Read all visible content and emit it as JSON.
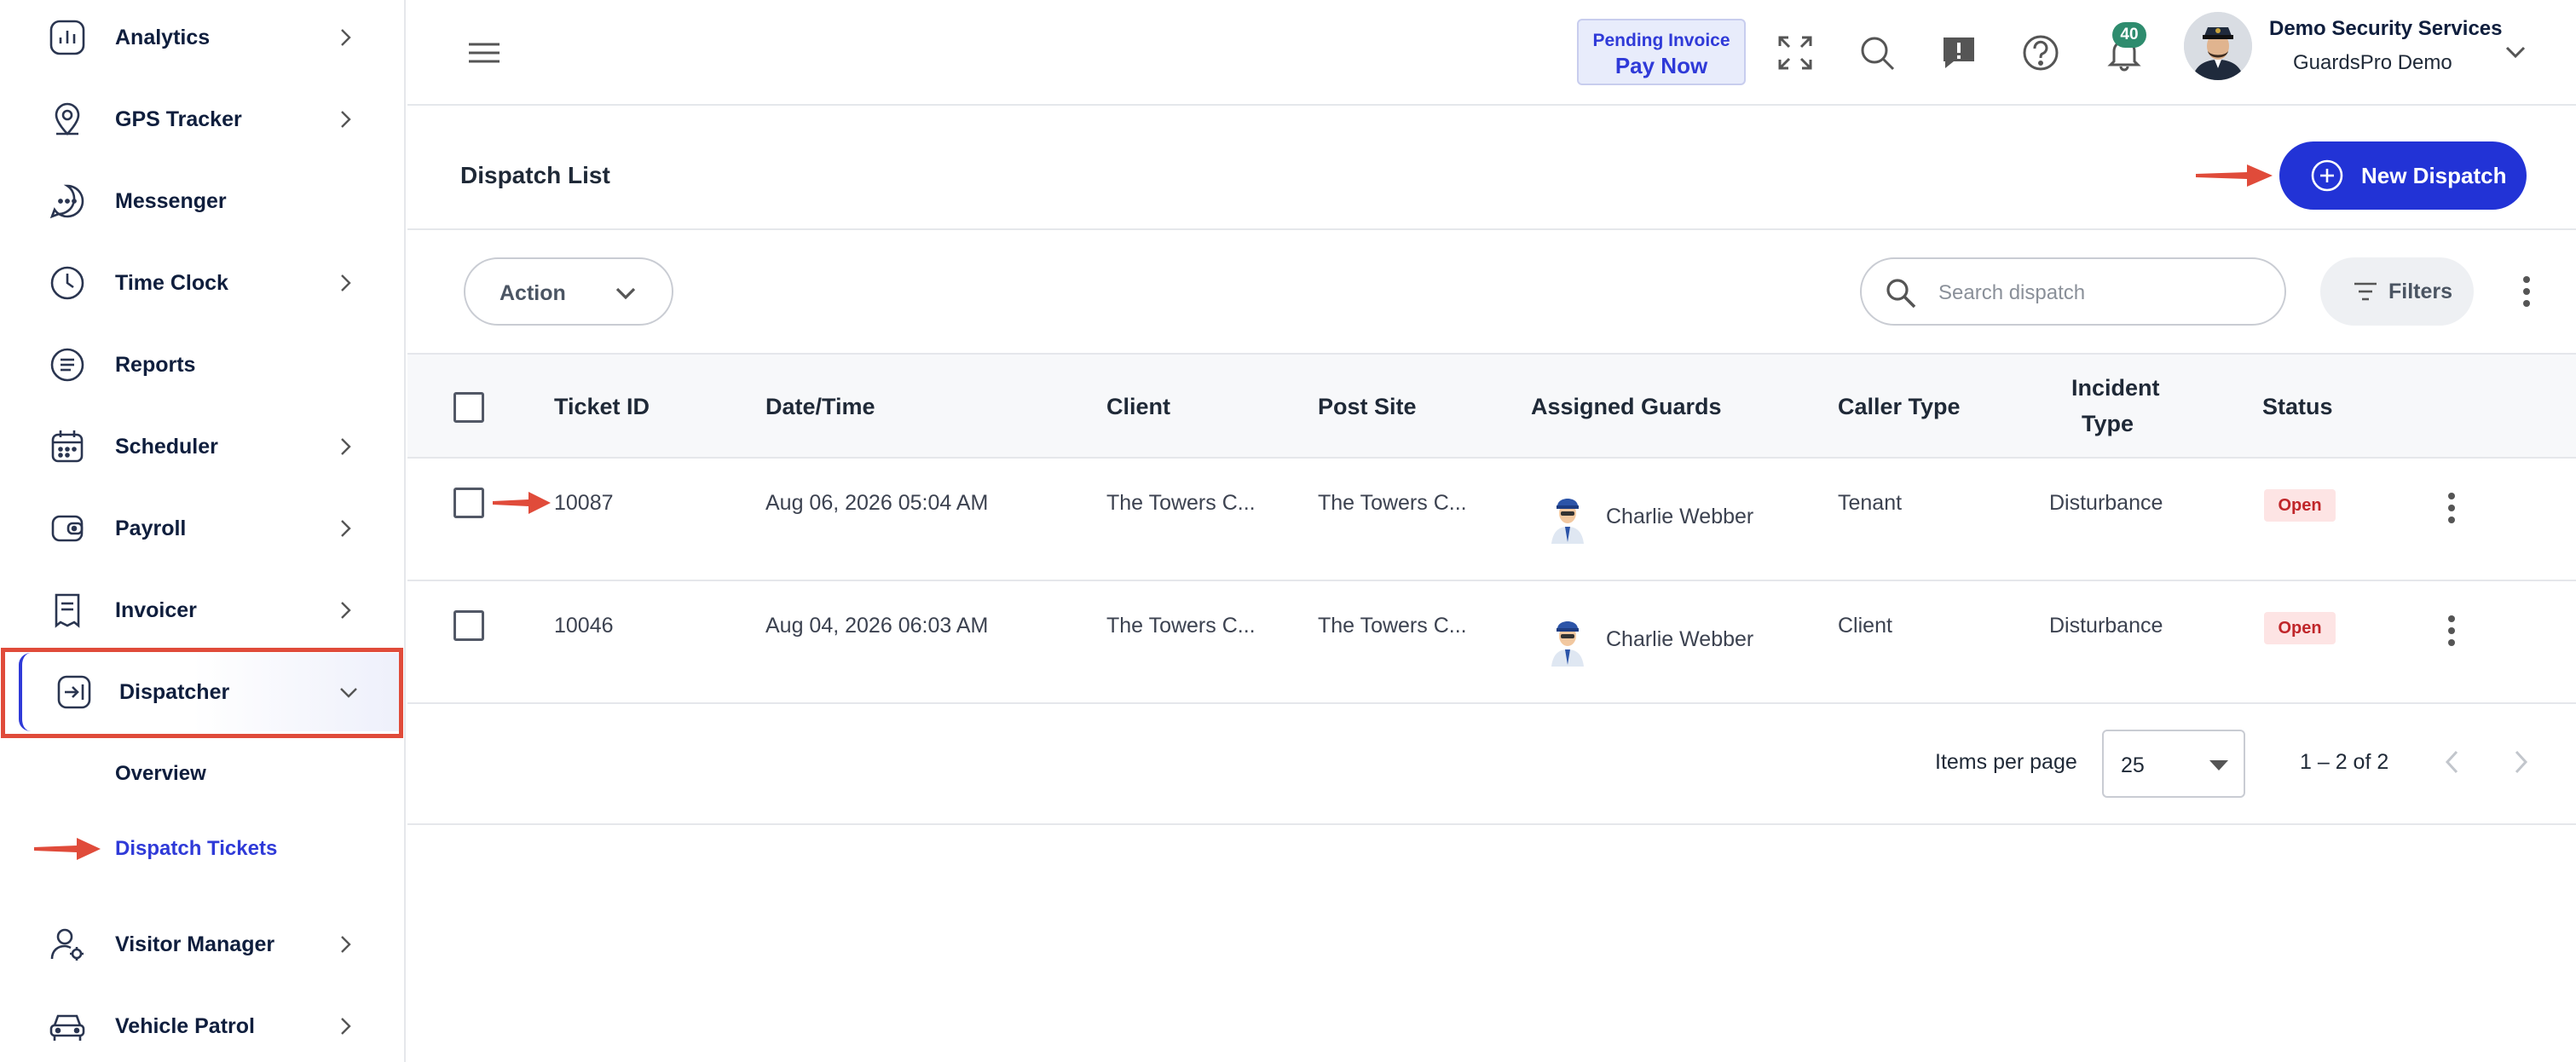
{
  "sidebar": {
    "items": [
      {
        "label": "Analytics",
        "icon": "analytics-icon"
      },
      {
        "label": "GPS Tracker",
        "icon": "map-pin-icon"
      },
      {
        "label": "Messenger",
        "icon": "chat-bubble-icon"
      },
      {
        "label": "Time Clock",
        "icon": "clock-icon"
      },
      {
        "label": "Reports",
        "icon": "report-icon"
      },
      {
        "label": "Scheduler",
        "icon": "calendar-icon"
      },
      {
        "label": "Payroll",
        "icon": "wallet-icon"
      },
      {
        "label": "Invoicer",
        "icon": "receipt-icon"
      },
      {
        "label": "Dispatcher",
        "icon": "dispatch-icon"
      },
      {
        "label": "Visitor Manager",
        "icon": "user-gear-icon"
      },
      {
        "label": "Vehicle Patrol",
        "icon": "car-icon"
      }
    ],
    "subitems": {
      "overview": "Overview",
      "dispatch_tickets": "Dispatch Tickets"
    }
  },
  "header": {
    "pending_invoice": "Pending Invoice",
    "pay_now": "Pay Now",
    "notification_count": "40",
    "user_name": "Demo Security Services",
    "user_org": "GuardsPro Demo"
  },
  "page": {
    "title": "Dispatch List",
    "new_button": "New Dispatch",
    "action": "Action",
    "search_placeholder": "Search dispatch",
    "filters": "Filters"
  },
  "table": {
    "headers": {
      "ticket_id": "Ticket ID",
      "datetime": "Date/Time",
      "client": "Client",
      "post_site": "Post Site",
      "assigned_guards": "Assigned Guards",
      "caller_type": "Caller Type",
      "incident_type_1": "Incident",
      "incident_type_2": "Type",
      "status": "Status"
    },
    "rows": [
      {
        "ticket_id": "10087",
        "datetime": "Aug 06, 2026 05:04 AM",
        "client": "The Towers C...",
        "post_site": "The Towers C...",
        "guard": "Charlie Webber",
        "caller_type": "Tenant",
        "incident_type": "Disturbance",
        "status": "Open"
      },
      {
        "ticket_id": "10046",
        "datetime": "Aug 04, 2026 06:03 AM",
        "client": "The Towers C...",
        "post_site": "The Towers C...",
        "guard": "Charlie Webber",
        "caller_type": "Client",
        "incident_type": "Disturbance",
        "status": "Open"
      }
    ]
  },
  "pagination": {
    "items_per_page_label": "Items per page",
    "items_per_page": "25",
    "range": "1 – 2 of 2"
  },
  "colors": {
    "accent": "#2233d6",
    "annotation": "#e04b3a",
    "status_open_bg": "#fde4e4",
    "status_open_text": "#c0262a",
    "badge": "#2e8c6e"
  }
}
